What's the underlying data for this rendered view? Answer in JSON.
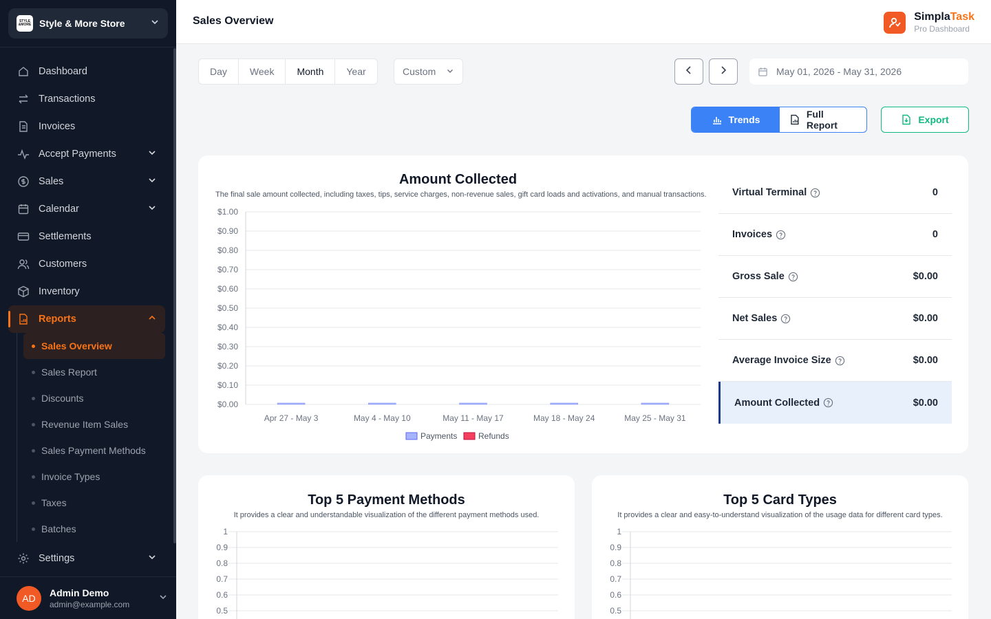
{
  "sidebar": {
    "store": {
      "logo_text": "STYLE &MORE",
      "name": "Style & More Store"
    },
    "items": [
      {
        "label": "Dashboard",
        "icon": "home-icon"
      },
      {
        "label": "Transactions",
        "icon": "arrows-swap-icon"
      },
      {
        "label": "Invoices",
        "icon": "document-icon"
      },
      {
        "label": "Accept Payments",
        "icon": "pulse-icon"
      },
      {
        "label": "Sales",
        "icon": "dollar-circle-icon"
      },
      {
        "label": "Calendar",
        "icon": "calendar-icon"
      },
      {
        "label": "Settlements",
        "icon": "credit-card-icon"
      },
      {
        "label": "Customers",
        "icon": "users-icon"
      },
      {
        "label": "Inventory",
        "icon": "box-icon"
      },
      {
        "label": "Reports",
        "icon": "report-icon"
      }
    ],
    "reports_sub": [
      "Sales Overview",
      "Sales Report",
      "Discounts",
      "Revenue Item Sales",
      "Sales Payment Methods",
      "Invoice Types",
      "Taxes",
      "Batches"
    ],
    "settings_label": "Settings",
    "user": {
      "initials": "AD",
      "name": "Admin Demo",
      "email": "admin@example.com"
    }
  },
  "header": {
    "title": "Sales Overview",
    "brand_name_a": "Simpla",
    "brand_name_b": "Task",
    "brand_sub": "Pro Dashboard"
  },
  "filters": {
    "periods": [
      "Day",
      "Week",
      "Month",
      "Year"
    ],
    "selected_period": "Month",
    "custom_label": "Custom",
    "date_range": "May 01, 2026 - May 31, 2026"
  },
  "actions": {
    "trends": "Trends",
    "full_report": "Full Report",
    "export": "Export"
  },
  "colors": {
    "accent": "#f97316",
    "primary": "#3b82f6",
    "export": "#10b981",
    "payments": "#a5b4fc",
    "refunds": "#f43f5e"
  },
  "amount_card": {
    "title": "Amount Collected",
    "subtitle": "The final sale amount collected, including taxes, tips, service charges, non-revenue sales, gift card loads and activations, and manual transactions."
  },
  "stats": [
    {
      "name": "Virtual Terminal",
      "value": "0"
    },
    {
      "name": "Invoices",
      "value": "0"
    },
    {
      "name": "Gross Sale",
      "value": "$0.00"
    },
    {
      "name": "Net Sales",
      "value": "$0.00"
    },
    {
      "name": "Average Invoice Size",
      "value": "$0.00"
    },
    {
      "name": "Amount Collected",
      "value": "$0.00"
    }
  ],
  "payment_card": {
    "title": "Top 5 Payment Methods",
    "subtitle": "It provides a clear and understandable visualization of the different payment methods used."
  },
  "card_types_card": {
    "title": "Top 5 Card Types",
    "subtitle": "It provides a clear and easy-to-understand visualization of the usage data for different card types."
  },
  "chart_data": [
    {
      "type": "bar",
      "title": "Amount Collected",
      "categories": [
        "Apr 27 - May 3",
        "May 4 - May 10",
        "May 11 - May 17",
        "May 18 - May 24",
        "May 25 - May 31"
      ],
      "series": [
        {
          "name": "Payments",
          "values": [
            0,
            0,
            0,
            0,
            0
          ]
        },
        {
          "name": "Refunds",
          "values": [
            0,
            0,
            0,
            0,
            0
          ]
        }
      ],
      "yticks": [
        "$0.00",
        "$0.10",
        "$0.20",
        "$0.30",
        "$0.40",
        "$0.50",
        "$0.60",
        "$0.70",
        "$0.80",
        "$0.90",
        "$1.00"
      ],
      "ylim": [
        0,
        1
      ],
      "legend": "bottom"
    },
    {
      "type": "bar",
      "title": "Top 5 Payment Methods",
      "yticks_visible": [
        "1",
        "0.9",
        "0.8",
        "0.7",
        "0.6",
        "0.5"
      ],
      "ylim": [
        0,
        1
      ]
    },
    {
      "type": "bar",
      "title": "Top 5 Card Types",
      "yticks_visible": [
        "1",
        "0.9",
        "0.8",
        "0.7",
        "0.6",
        "0.5"
      ],
      "ylim": [
        0,
        1
      ]
    }
  ]
}
